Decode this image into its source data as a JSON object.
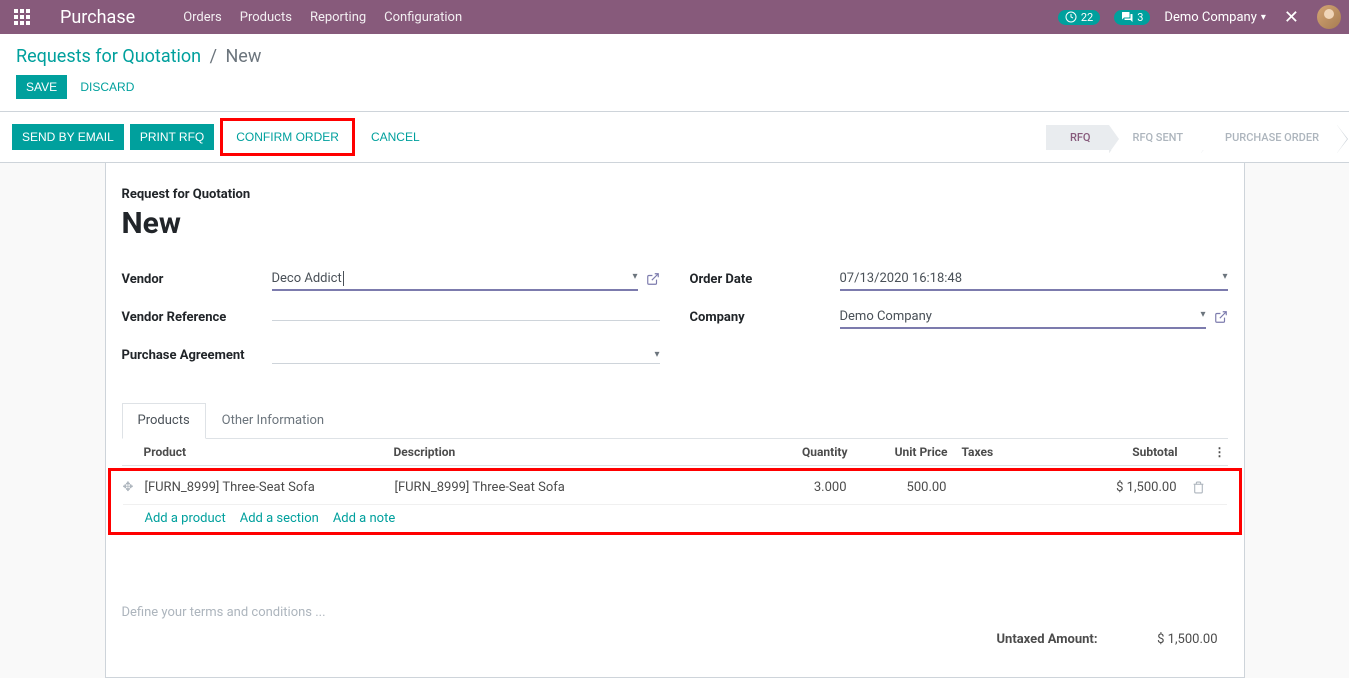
{
  "navbar": {
    "app_name": "Purchase",
    "menu": [
      {
        "label": "Orders"
      },
      {
        "label": "Products"
      },
      {
        "label": "Reporting"
      },
      {
        "label": "Configuration"
      }
    ],
    "activity_count": "22",
    "messages_count": "3",
    "company": "Demo Company"
  },
  "breadcrumb": {
    "root": "Requests for Quotation",
    "current": "New"
  },
  "buttons": {
    "save": "SAVE",
    "discard": "DISCARD",
    "send_email": "SEND BY EMAIL",
    "print_rfq": "PRINT RFQ",
    "confirm_order": "CONFIRM ORDER",
    "cancel": "CANCEL"
  },
  "status": {
    "rfq": "RFQ",
    "rfq_sent": "RFQ SENT",
    "po": "PURCHASE ORDER"
  },
  "form": {
    "title_small": "Request for Quotation",
    "title_big": "New",
    "labels": {
      "vendor": "Vendor",
      "vendor_ref": "Vendor Reference",
      "purchase_agreement": "Purchase Agreement",
      "order_date": "Order Date",
      "company": "Company"
    },
    "values": {
      "vendor": "Deco Addict",
      "vendor_ref": "",
      "purchase_agreement": "",
      "order_date": "07/13/2020 16:18:48",
      "company": "Demo Company"
    }
  },
  "tabs": {
    "products": "Products",
    "other": "Other Information"
  },
  "table": {
    "headers": {
      "product": "Product",
      "description": "Description",
      "quantity": "Quantity",
      "unit_price": "Unit Price",
      "taxes": "Taxes",
      "subtotal": "Subtotal"
    },
    "rows": [
      {
        "product": "[FURN_8999] Three-Seat Sofa",
        "description": "[FURN_8999] Three-Seat Sofa",
        "quantity": "3.000",
        "unit_price": "500.00",
        "taxes": "",
        "subtotal": "$ 1,500.00"
      }
    ],
    "add_product": "Add a product",
    "add_section": "Add a section",
    "add_note": "Add a note"
  },
  "terms_placeholder": "Define your terms and conditions ...",
  "totals": {
    "untaxed_label": "Untaxed Amount:",
    "untaxed_value": "$ 1,500.00"
  }
}
